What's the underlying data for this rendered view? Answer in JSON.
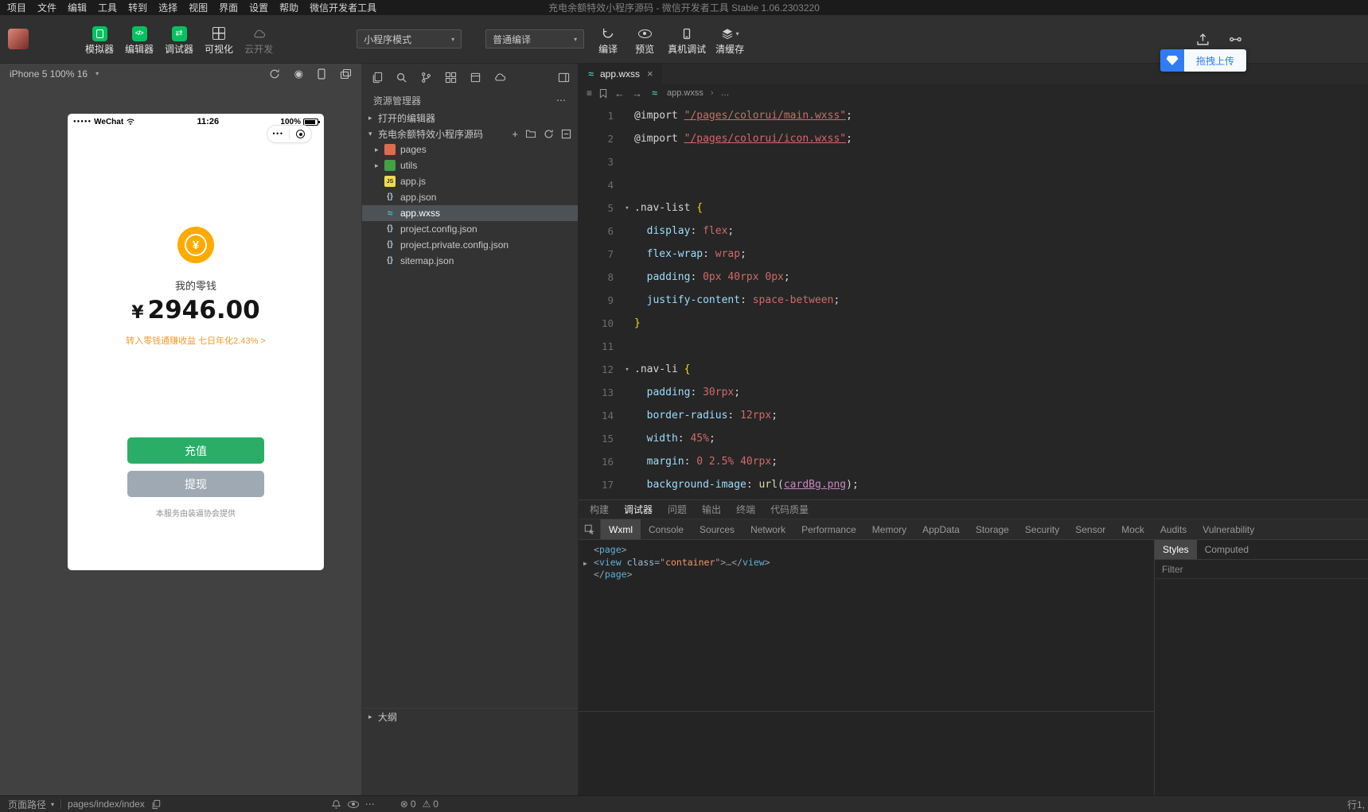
{
  "menubar": {
    "items": [
      "项目",
      "文件",
      "编辑",
      "工具",
      "转到",
      "选择",
      "视图",
      "界面",
      "设置",
      "帮助",
      "微信开发者工具"
    ],
    "title": "充电余额特效小程序源码 - 微信开发者工具 Stable 1.06.2303220"
  },
  "toolbar": {
    "buttons": [
      {
        "label": "模拟器"
      },
      {
        "label": "编辑器"
      },
      {
        "label": "调试器"
      },
      {
        "label": "可视化"
      },
      {
        "label": "云开发"
      }
    ],
    "mode_select": "小程序模式",
    "compile_select": "普通编译",
    "actions": [
      {
        "label": "编译"
      },
      {
        "label": "预览"
      },
      {
        "label": "真机调试"
      },
      {
        "label": "清缓存"
      }
    ],
    "drag_upload_label": "拖拽上传"
  },
  "simulator": {
    "device_label": "iPhone 5 100% 16",
    "phone": {
      "carrier_dots": "●●●●●",
      "carrier": "WeChat",
      "time": "11:26",
      "battery_percent": "100%",
      "capsule_dots": "•••",
      "currency": "¥",
      "wallet_label": "我的零钱",
      "balance": "2946.00",
      "promo_link": "转入零钱通赚收益 七日年化2.43% >",
      "recharge_button": "充值",
      "withdraw_button": "提现",
      "footer_note": "本服务由装逼协会提供"
    }
  },
  "explorer": {
    "header": "资源管理器",
    "open_editors_label": "打开的编辑器",
    "project_name": "充电余额特效小程序源码",
    "files": [
      {
        "name": "pages",
        "icon": "pages-folder-icon",
        "folder": true
      },
      {
        "name": "utils",
        "icon": "utils-folder-icon",
        "folder": true
      },
      {
        "name": "app.js",
        "icon": "js-icon"
      },
      {
        "name": "app.json",
        "icon": "json-icon"
      },
      {
        "name": "app.wxss",
        "icon": "wxss-icon",
        "selected": true
      },
      {
        "name": "project.config.json",
        "icon": "json-icon"
      },
      {
        "name": "project.private.config.json",
        "icon": "json-icon"
      },
      {
        "name": "sitemap.json",
        "icon": "json-icon"
      }
    ],
    "outline_label": "大纲"
  },
  "editor": {
    "tab_label": "app.wxss",
    "breadcrumb_file": "app.wxss",
    "breadcrumb_more": "…",
    "code_lines": [
      {
        "n": 1,
        "tokens": [
          [
            "p",
            "@import "
          ],
          [
            "s",
            "\"/pages/colorui/main.wxss\""
          ],
          [
            "p",
            ";"
          ]
        ]
      },
      {
        "n": 2,
        "tokens": [
          [
            "p",
            "@import "
          ],
          [
            "s",
            "\"/pages/colorui/icon.wxss\""
          ],
          [
            "p",
            ";"
          ]
        ]
      },
      {
        "n": 3,
        "tokens": []
      },
      {
        "n": 4,
        "tokens": []
      },
      {
        "n": 5,
        "fold": true,
        "tokens": [
          [
            "sel",
            ".nav-list"
          ],
          [
            "p",
            " "
          ],
          [
            "br",
            "{"
          ]
        ]
      },
      {
        "n": 6,
        "tokens": [
          [
            "p",
            "  "
          ],
          [
            "pr",
            "display"
          ],
          [
            "p",
            ": "
          ],
          [
            "v",
            "flex"
          ],
          [
            "p",
            ";"
          ]
        ]
      },
      {
        "n": 7,
        "tokens": [
          [
            "p",
            "  "
          ],
          [
            "pr",
            "flex-wrap"
          ],
          [
            "p",
            ": "
          ],
          [
            "v",
            "wrap"
          ],
          [
            "p",
            ";"
          ]
        ]
      },
      {
        "n": 8,
        "tokens": [
          [
            "p",
            "  "
          ],
          [
            "pr",
            "padding"
          ],
          [
            "p",
            ": "
          ],
          [
            "v",
            "0px 40rpx 0px"
          ],
          [
            "p",
            ";"
          ]
        ]
      },
      {
        "n": 9,
        "tokens": [
          [
            "p",
            "  "
          ],
          [
            "pr",
            "justify-content"
          ],
          [
            "p",
            ": "
          ],
          [
            "v",
            "space-between"
          ],
          [
            "p",
            ";"
          ]
        ]
      },
      {
        "n": 10,
        "tokens": [
          [
            "br",
            "}"
          ]
        ]
      },
      {
        "n": 11,
        "tokens": []
      },
      {
        "n": 12,
        "fold": true,
        "tokens": [
          [
            "sel",
            ".nav-li"
          ],
          [
            "p",
            " "
          ],
          [
            "br",
            "{"
          ]
        ]
      },
      {
        "n": 13,
        "tokens": [
          [
            "p",
            "  "
          ],
          [
            "pr",
            "padding"
          ],
          [
            "p",
            ": "
          ],
          [
            "v",
            "30rpx"
          ],
          [
            "p",
            ";"
          ]
        ]
      },
      {
        "n": 14,
        "tokens": [
          [
            "p",
            "  "
          ],
          [
            "pr",
            "border-radius"
          ],
          [
            "p",
            ": "
          ],
          [
            "v",
            "12rpx"
          ],
          [
            "p",
            ";"
          ]
        ]
      },
      {
        "n": 15,
        "tokens": [
          [
            "p",
            "  "
          ],
          [
            "pr",
            "width"
          ],
          [
            "p",
            ": "
          ],
          [
            "v",
            "45%"
          ],
          [
            "p",
            ";"
          ]
        ]
      },
      {
        "n": 16,
        "tokens": [
          [
            "p",
            "  "
          ],
          [
            "pr",
            "margin"
          ],
          [
            "p",
            ": "
          ],
          [
            "v",
            "0 2.5% 40rpx"
          ],
          [
            "p",
            ";"
          ]
        ]
      },
      {
        "n": 17,
        "tokens": [
          [
            "p",
            "  "
          ],
          [
            "pr",
            "background-image"
          ],
          [
            "p",
            ": "
          ],
          [
            "fn",
            "url"
          ],
          [
            "p",
            "("
          ],
          [
            "lk",
            "cardBg.png"
          ],
          [
            "p",
            ");"
          ]
        ]
      }
    ]
  },
  "debugger": {
    "panel_tabs": [
      "构建",
      "调试器",
      "问题",
      "输出",
      "终端",
      "代码质量"
    ],
    "active_panel_tab": "调试器",
    "devtool_tabs": [
      "Wxml",
      "Console",
      "Sources",
      "Network",
      "Performance",
      "Memory",
      "AppData",
      "Storage",
      "Security",
      "Sensor",
      "Mock",
      "Audits",
      "Vulnerability"
    ],
    "active_devtool_tab": "Wxml",
    "wxml_lines": [
      {
        "tokens": [
          [
            "wb",
            "<"
          ],
          [
            "wt",
            "page"
          ],
          [
            "wb",
            ">"
          ]
        ]
      },
      {
        "exp": true,
        "tokens": [
          [
            "wb",
            "<"
          ],
          [
            "wt",
            "view"
          ],
          [
            "wp",
            " "
          ],
          [
            "wa",
            "class"
          ],
          [
            "wb",
            "=\""
          ],
          [
            "wv",
            "container"
          ],
          [
            "wb",
            "\">"
          ],
          [
            "wd",
            "…"
          ],
          [
            "wb",
            "</"
          ],
          [
            "wt",
            "view"
          ],
          [
            "wb",
            ">"
          ]
        ]
      },
      {
        "tokens": [
          [
            "wb",
            "</"
          ],
          [
            "wt",
            "page"
          ],
          [
            "wb",
            ">"
          ]
        ]
      }
    ],
    "styles_tabs": [
      "Styles",
      "Computed"
    ],
    "active_styles_tab": "Styles",
    "filter_placeholder": "Filter"
  },
  "statusbar": {
    "page_path_label": "页面路径",
    "page_path": "pages/index/index",
    "error_count": "0",
    "warning_count": "0",
    "line_info": "行1,"
  },
  "colors": {
    "wechat_green": "#07c160",
    "recharge_green": "#2aae67",
    "withdraw_gray": "#9fa9b3",
    "coin_orange": "#ffaa00",
    "promo_orange": "#f59b2c",
    "upload_blue": "#2f7df6"
  }
}
